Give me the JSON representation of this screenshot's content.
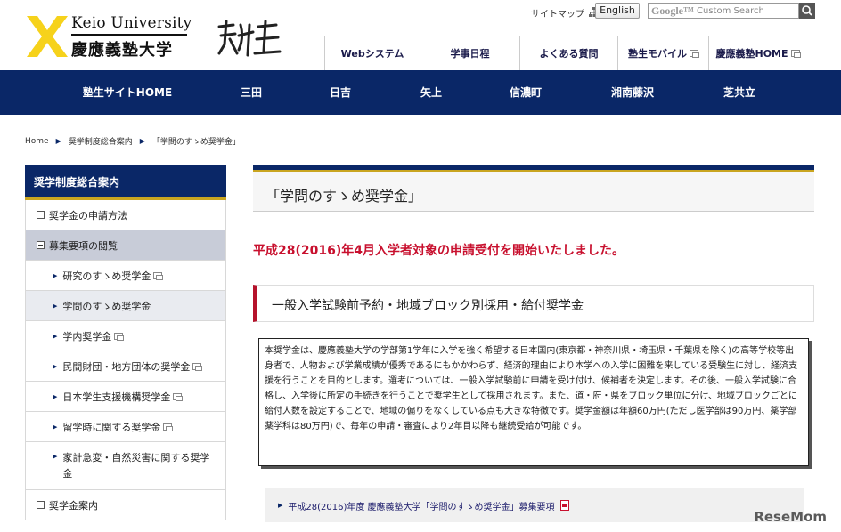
{
  "header": {
    "logo_en": "Keio University",
    "logo_jp": "慶應義塾大学",
    "sitemap_label": "サイトマップ",
    "english_label": "English",
    "search": {
      "google_label": "Google™",
      "placeholder": "Custom Search"
    },
    "top_nav": [
      {
        "label": "Webシステム"
      },
      {
        "label": "学事日程"
      },
      {
        "label": "よくある質問"
      },
      {
        "label": "塾生モバイル"
      },
      {
        "label": "慶應義塾HOME"
      }
    ]
  },
  "main_nav": [
    {
      "label": "塾生サイトHOME"
    },
    {
      "label": "三田"
    },
    {
      "label": "日吉"
    },
    {
      "label": "矢上"
    },
    {
      "label": "信濃町"
    },
    {
      "label": "湘南藤沢"
    },
    {
      "label": "芝共立"
    }
  ],
  "breadcrumb": [
    "Home",
    "奨学制度総合案内",
    "「学問のすゝめ奨学金」"
  ],
  "sidebar": {
    "title": "奨学制度総合案内",
    "items": [
      {
        "label": "奨学金の申請方法"
      },
      {
        "label": "募集要項の閲覧"
      },
      {
        "label": "研究のすゝめ奨学金"
      },
      {
        "label": "学問のすゝめ奨学金"
      },
      {
        "label": "学内奨学金"
      },
      {
        "label": "民間財団・地方団体の奨学金"
      },
      {
        "label": "日本学生支援機構奨学金"
      },
      {
        "label": "留学時に関する奨学金"
      },
      {
        "label": "家計急変・自然災害に関する奨学金"
      },
      {
        "label": "奨学金案内"
      }
    ]
  },
  "content": {
    "title": "「学問のすゝめ奨学金」",
    "notice": "平成28(2016)年4月入学者対象の申請受付を開始いたしました。",
    "section_heading": "一般入学試験前予約・地域ブロック別採用・給付奨学金",
    "description": "本奨学金は、慶應義塾大学の学部第1学年に入学を強く希望する日本国内(東京都・神奈川県・埼玉県・千葉県を除く)の高等学校等出身者で、人物および学業成績が優秀であるにもかかわらず、経済的理由により本学への入学に困難を来している受験生に対し、経済支援を行うことを目的とします。選考については、一般入学試験前に申請を受け付け、候補者を決定します。その後、一般入学試験に合格し、入学後に所定の手続きを行うことで奨学生として採用されます。また、道・府・県をブロック単位に分け、地域ブロックごとに給付人数を設定することで、地域の偏りをなくしている点も大きな特徴です。奨学金額は年額60万円(ただし医学部は90万円、薬学部薬学科は80万円)で、毎年の申請・審査により2年目以降も継続受給が可能です。",
    "link_label": "平成28(2016)年度 慶應義塾大学「学問のすゝめ奨学金」募集要項"
  },
  "watermark": "ReseMom",
  "colors": {
    "navy": "#0a2767",
    "gold": "#c9a520",
    "red": "#c8102e"
  },
  "icons": [
    "keio-pen-logo-icon",
    "calligraphy-logo",
    "sitemap-icon",
    "search-icon",
    "external-window-icon",
    "triangle-bullet-icon",
    "minus-box-icon",
    "plus-box-icon",
    "pdf-icon"
  ]
}
